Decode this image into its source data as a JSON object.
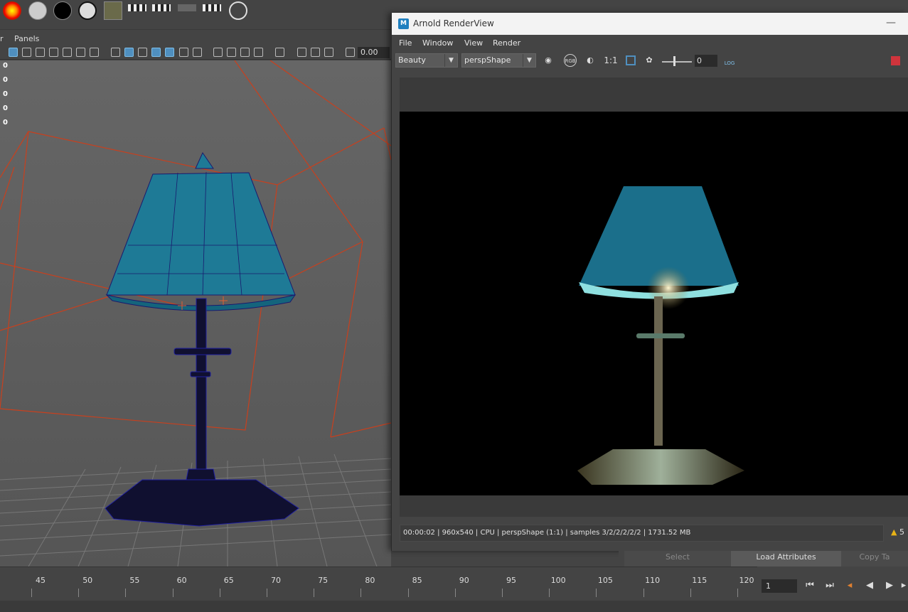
{
  "viewport": {
    "menu": {
      "partial_label": "r",
      "panels_label": "Panels"
    },
    "field_value": "0.00",
    "hud_values": [
      "0",
      "0",
      "0",
      "0",
      "0"
    ]
  },
  "render_view": {
    "title": "Arnold RenderView",
    "title_icon": "M",
    "minimize_glyph": "—",
    "menu": [
      "File",
      "Window",
      "View",
      "Render"
    ],
    "aov": "Beauty",
    "camera": "perspShape",
    "ratio_label": "1:1",
    "exposure": "0",
    "log_label": "LOG",
    "rgb_label": "RGB",
    "status": "00:00:02 | 960x540 | CPU | perspShape (1:1) | samples 3/2/2/2/2/2 | 1731.52 MB",
    "warning_count": "5",
    "stop_color": "#d0343c"
  },
  "attr_editor": {
    "select_label": "Select",
    "load_label": "Load Attributes",
    "copy_label": "Copy Ta"
  },
  "timeline": {
    "ticks": [
      "45",
      "50",
      "55",
      "60",
      "65",
      "70",
      "75",
      "80",
      "85",
      "90",
      "95",
      "100",
      "105",
      "110",
      "115",
      "120"
    ],
    "current_frame": "1"
  },
  "colors": {
    "lamp_shade": "#1e7a96",
    "wire_red": "#c8401e",
    "accent_blue": "#4f8fbf"
  }
}
